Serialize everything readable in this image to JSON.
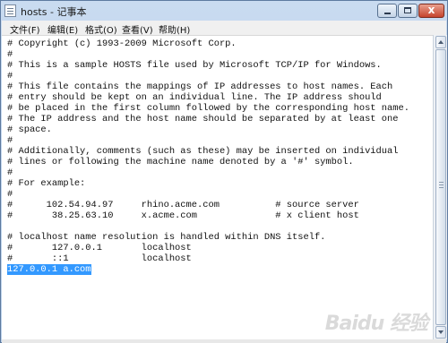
{
  "window": {
    "title": "hosts - 记事本"
  },
  "menu": [
    {
      "label": "文件(F)"
    },
    {
      "label": "编辑(E)"
    },
    {
      "label": "格式(O)"
    },
    {
      "label": "查看(V)"
    },
    {
      "label": "帮助(H)"
    }
  ],
  "editor": {
    "lines": [
      "# Copyright (c) 1993-2009 Microsoft Corp.",
      "#",
      "# This is a sample HOSTS file used by Microsoft TCP/IP for Windows.",
      "#",
      "# This file contains the mappings of IP addresses to host names. Each",
      "# entry should be kept on an individual line. The IP address should",
      "# be placed in the first column followed by the corresponding host name.",
      "# The IP address and the host name should be separated by at least one",
      "# space.",
      "#",
      "# Additionally, comments (such as these) may be inserted on individual",
      "# lines or following the machine name denoted by a '#' symbol.",
      "#",
      "# For example:",
      "#",
      "#      102.54.94.97     rhino.acme.com          # source server",
      "#       38.25.63.10     x.acme.com              # x client host",
      "",
      "# localhost name resolution is handled within DNS itself.",
      "#       127.0.0.1       localhost",
      "#       ::1             localhost"
    ],
    "selected_line": "127.0.0.1 a.com"
  },
  "icons": {
    "app": "notepad-icon",
    "minimize": "minimize-icon",
    "maximize": "maximize-icon",
    "close": "close-icon"
  },
  "watermark": "Baidu 经验"
}
